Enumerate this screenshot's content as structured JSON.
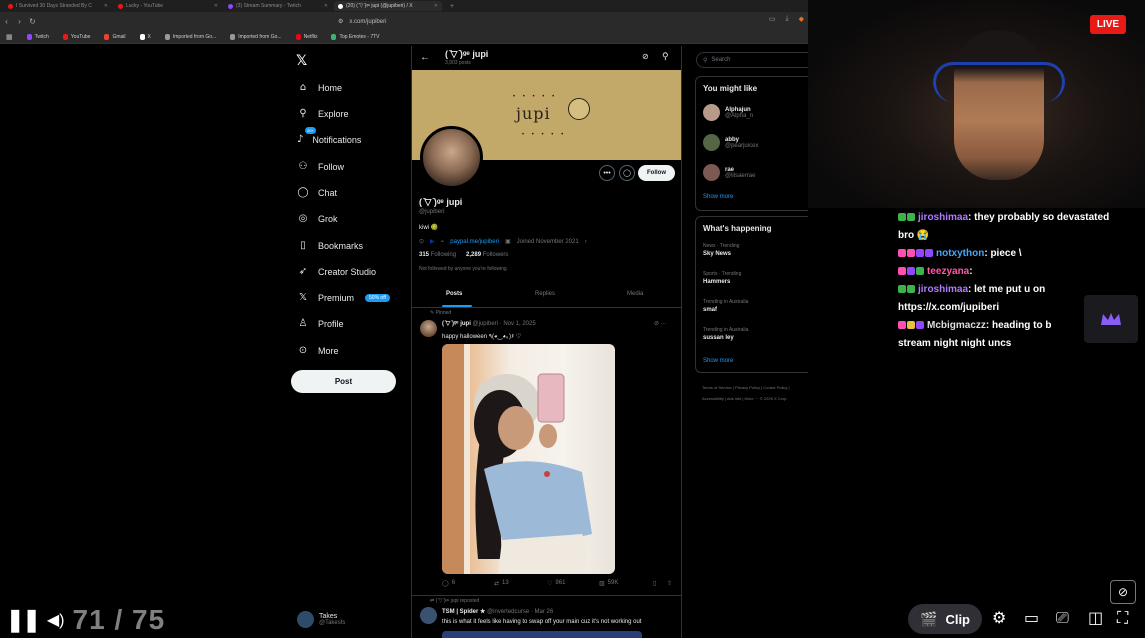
{
  "browser": {
    "tabs": [
      {
        "label": "I Survived 30 Days Stranded By C",
        "color": "#e91916"
      },
      {
        "label": "Lucky - YouTube",
        "color": "#e91916"
      },
      {
        "label": "(3) Stream Summary - Twitch",
        "color": "#9146ff"
      },
      {
        "label": "(20) ( ̄▽ ̄)ᵍᵉ jupi (@jupiberi) / X",
        "color": "#ffffff"
      }
    ],
    "new_tab": "+",
    "url": "x.com/jupiberi",
    "bookmarks": [
      {
        "label": "Twitch",
        "color": "#9146ff"
      },
      {
        "label": "YouTube",
        "color": "#e91916"
      },
      {
        "label": "Gmail",
        "color": "#ea4335"
      },
      {
        "label": "X",
        "color": "#ffffff"
      },
      {
        "label": "Imported from Go...",
        "color": "#999999"
      },
      {
        "label": "Imported from Go...",
        "color": "#999999"
      },
      {
        "label": "Netflix",
        "color": "#e50914"
      },
      {
        "label": "Top Emotes - 7TV",
        "color": "#3cb371"
      }
    ]
  },
  "xnav": {
    "logo": "𝕏",
    "items": [
      {
        "label": "Home",
        "icon": "⌂",
        "icon_name": "home-icon"
      },
      {
        "label": "Explore",
        "icon": "⚲",
        "icon_name": "search-icon"
      },
      {
        "label": "Notifications",
        "icon": "♪",
        "icon_name": "bell-icon",
        "badge": "20+"
      },
      {
        "label": "Follow",
        "icon": "⚇",
        "icon_name": "follow-icon"
      },
      {
        "label": "Chat",
        "icon": "◯",
        "icon_name": "chat-icon"
      },
      {
        "label": "Grok",
        "icon": "◎",
        "icon_name": "grok-icon"
      },
      {
        "label": "Bookmarks",
        "icon": "▯",
        "icon_name": "bookmark-icon"
      },
      {
        "label": "Creator Studio",
        "icon": "➶",
        "icon_name": "creator-studio-icon"
      },
      {
        "label": "Premium",
        "icon": "𝕏",
        "icon_name": "premium-icon",
        "pill": "50% off"
      },
      {
        "label": "Profile",
        "icon": "♙",
        "icon_name": "profile-icon"
      },
      {
        "label": "More",
        "icon": "⊙",
        "icon_name": "more-icon"
      }
    ],
    "post_label": "Post",
    "account": {
      "name": "Takes",
      "handle": "@Takesfs"
    }
  },
  "profile": {
    "header_name": "( ̄▽ ̄)ᵍᵉ jupi",
    "header_posts": "3,903 posts",
    "banner_text": "jupi",
    "banner_dots": "• • • • •",
    "follow_label": "Follow",
    "name": "( ̄▽ ̄)ᵍᵉ jupi",
    "handle": "@jupiberi",
    "bio": "kiwi 🥝",
    "link": "paypal.me/jupiberi",
    "joined": "Joined November 2021",
    "following_count": "315",
    "following_label": "Following",
    "followers_count": "2,289",
    "followers_label": "Followers",
    "followed_note": "Not followed by anyone you're following",
    "tabs": [
      "Posts",
      "Replies",
      "Media"
    ]
  },
  "post": {
    "pinned_label": "Pinned",
    "name": "( ̄▽ ̄)ᵍᵉ jupi",
    "handle_date": "@jupiberi · Nov 1, 2025",
    "text": "happy halloween ٩(◕‿◕｡)۶ ♡",
    "replies": "6",
    "reposts": "13",
    "likes": "961",
    "views": "59K"
  },
  "post2": {
    "repost_label": "( ̄▽ ̄)ᵍᵉ jupi reposted",
    "name": "TSM | Spider ★",
    "handle_date": "@invertedcurse · Mar 26",
    "text": "this is what it feels like having to swap off your main cuz it's not working out"
  },
  "right": {
    "search_placeholder": "Search",
    "ymll_title": "You might like",
    "suggestions": [
      {
        "name": "Alphajun",
        "handle": "@Alpha_n",
        "color": "#b89a88"
      },
      {
        "name": "abby",
        "handle": "@pearjuicex",
        "color": "#556644"
      },
      {
        "name": "rae",
        "handle": "@lilsaerrae",
        "color": "#7a5a52"
      }
    ],
    "show_more": "Show more",
    "happening_title": "What's happening",
    "trends": [
      {
        "category": "News · Trending",
        "name": "Sky News"
      },
      {
        "category": "Sports · Trending",
        "name": "Hammers"
      },
      {
        "category": "Trending in Australia",
        "name": "smaf"
      },
      {
        "category": "Trending in Australia",
        "name": "sussan ley"
      }
    ],
    "show_more2": "Show more",
    "footer_line1": "Terms of Service | Privacy Policy | Cookie Policy |",
    "footer_line2": "Accessibility | Ads info | More ··· © 2026 X Corp."
  },
  "stream": {
    "live_label": "LIVE",
    "chat": [
      {
        "user": "jiroshimaa",
        "user_color": "#b07cff",
        "msg": "they probably so devastated",
        "msg2": "bro 😭",
        "badges": [
          "#3cb34a",
          "#3cb34a"
        ]
      },
      {
        "user": "notxython",
        "user_color": "#3fa9ff",
        "msg": "piece \\",
        "badges": [
          "#ff4fb1",
          "#ff4fb1",
          "#9146ff",
          "#9146ff"
        ]
      },
      {
        "user": "teezyana",
        "user_color": "#ff5aa6",
        "msg": "",
        "badges": [
          "#ff4fb1",
          "#9146ff",
          "#3cb34a"
        ]
      },
      {
        "user": "jiroshimaa",
        "user_color": "#b07cff",
        "msg": "let me put u on",
        "badges": [
          "#3cb34a",
          "#3cb34a"
        ]
      },
      {
        "user": "",
        "user_color": "#ffffff",
        "msg": "https://x.com/jupiberi",
        "badges": []
      },
      {
        "user": "Mcbigmaczz",
        "user_color": "#dddddd",
        "msg": "heading to b",
        "msg2": "stream night night uncs",
        "badges": [
          "#ff4fb1",
          "#e8c23a",
          "#9146ff"
        ]
      }
    ],
    "clip_label": "Clip",
    "overlay_numbers": "71 / 75",
    "crown_color": "#8a5cf6"
  }
}
